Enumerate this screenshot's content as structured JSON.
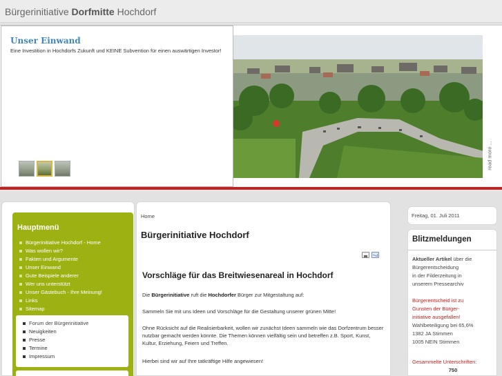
{
  "header": {
    "title_part1": "Bürgerinitiative",
    "title_part2": "Dorfmitte",
    "title_part3": "Hochdorf"
  },
  "banner": {
    "title": "Unser Einwand",
    "description": "Eine Investition in Hochdorfs Zukunft und KEINE Subvention für einen auswärtigen Investor!",
    "read_more": "read more ..."
  },
  "left": {
    "menu_title": "Hauptmenü",
    "menu_items": [
      "Bürgerinitiative Hochdorf - Home",
      "Was wollen wir?",
      "Fakten und Argumente",
      "Unser Einwand",
      "Gute Beispiele anderer",
      "Wer uns unterstützt",
      "Unser Gästebuch - Ihre Meinung!",
      "Links",
      "Sitemap"
    ],
    "sub_items": [
      "Forum der Bürgerinitiative",
      "Neuigkeiten",
      "Presse",
      "Termine",
      "Impressum"
    ]
  },
  "main": {
    "breadcrumb": "Home",
    "page_title": "Bürgerinitiative Hochdorf",
    "article_title": "Vorschläge für das Breitwiesenareal in Hochdorf",
    "p1_pre": "Die ",
    "p1_b1": "Bürgerinitiative",
    "p1_mid": " ruft die ",
    "p1_b2": "Hochdorfer",
    "p1_post": " Bürger zur Mitgestaltung auf:",
    "p2": "Sammeln Sie mit uns Ideen und Vorschläge für die Gestaltung unserer grünen Mitte!",
    "p3": "Ohne Rücksicht auf die Realisierbarkeit, wollen wir zunächst Ideen sammeln wie das Dorfzentrum besser nutzbar gemacht werden könnte. Die Themen können vielfältig sein und betreffen z.B. Sport, Kunst, Kultur, Erziehung, Feiern und Treffen.",
    "p4": "Hierbei sind wir auf Ihre tatkräftige Hilfe angewiesen!"
  },
  "right": {
    "date": "Freitag, 01. Juli 2011",
    "news_title": "Blitzmeldungen",
    "n1_bold": "Aktueller Artikel",
    "n1_rest": " über die",
    "n2": "Bürgerentscheidung",
    "n3": "in der Filderzeitung in",
    "n4": "unserem Pressearchiv",
    "n5": "Bürgerentscheid ist zu",
    "n6": "Gunsten der Bürger-",
    "n7": "initiative ausgefallen!",
    "n8": "Wahlbeteiligung bei 65,6%",
    "n9": "1382 JA Stimmen",
    "n10": "1005 NEIN Stimmen",
    "n11": "Gesammelte Unterschriften:",
    "n12": "750"
  },
  "colors": {
    "accent_green": "#9eb113",
    "accent_red": "#c81f1f",
    "title_blue": "#3f86b9"
  }
}
